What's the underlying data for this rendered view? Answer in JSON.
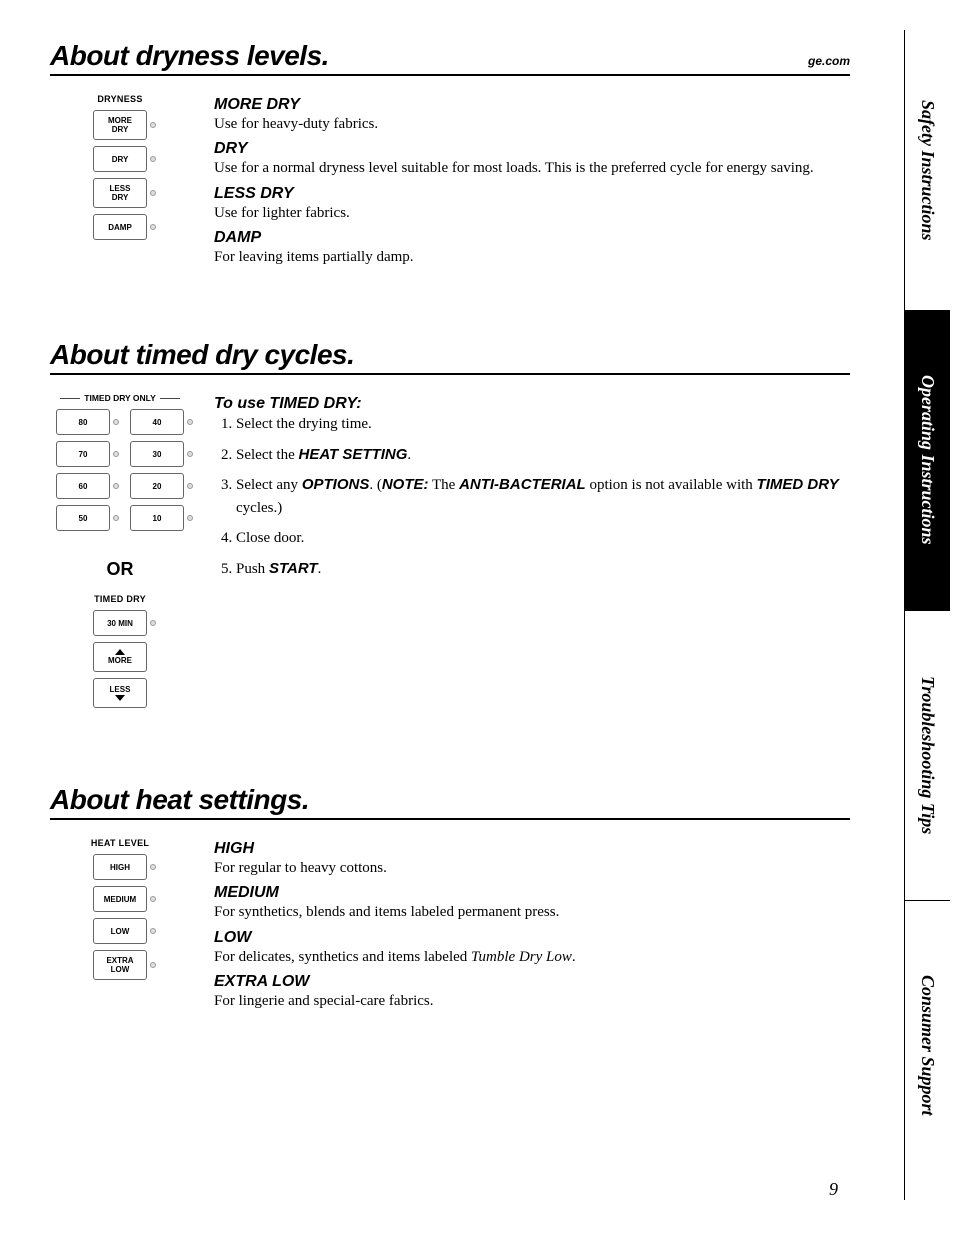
{
  "brand_link": "ge.com",
  "page_number": "9",
  "side_tabs": {
    "safety": "Safety Instructions",
    "operating": "Operating Instructions",
    "troubleshooting": "Troubleshooting Tips",
    "consumer": "Consumer Support"
  },
  "dryness": {
    "title": "About dryness levels.",
    "panel_label": "DRYNESS",
    "buttons": [
      {
        "line1": "MORE",
        "line2": "DRY"
      },
      {
        "line1": "DRY"
      },
      {
        "line1": "LESS",
        "line2": "DRY"
      },
      {
        "line1": "DAMP"
      }
    ],
    "items": [
      {
        "heading": "MORE DRY",
        "body": "Use for heavy-duty fabrics."
      },
      {
        "heading": "DRY",
        "body": "Use for a normal dryness level suitable for most loads. This is the preferred cycle for energy saving."
      },
      {
        "heading": "LESS DRY",
        "body": "Use for lighter fabrics."
      },
      {
        "heading": "DAMP",
        "body": "For leaving items partially damp."
      }
    ]
  },
  "timed": {
    "title": "About timed dry cycles.",
    "panel_label_a": "TIMED DRY ONLY",
    "buttons_left": [
      "80",
      "70",
      "60",
      "50"
    ],
    "buttons_right": [
      "40",
      "30",
      "20",
      "10"
    ],
    "or_label": "OR",
    "panel_label_b": "TIMED DRY",
    "btn_30min": "30 MIN",
    "btn_more": "MORE",
    "btn_less": "LESS",
    "subheading": "To use TIMED DRY:",
    "steps": {
      "s1": "Select the drying time.",
      "s2_pre": "Select the ",
      "s2_bold": "HEAT SETTING",
      "s2_post": ".",
      "s3_pre": "Select any ",
      "s3_bold1": "OPTIONS",
      "s3_mid1": ". (",
      "s3_bold2": "NOTE:",
      "s3_mid2": " The ",
      "s3_bold3": "ANTI-BACTERIAL",
      "s3_mid3": " option is not available with ",
      "s3_bold4": "TIMED DRY",
      "s3_post": " cycles.)",
      "s4": "Close door.",
      "s5_pre": "Push ",
      "s5_bold": "START",
      "s5_post": "."
    }
  },
  "heat": {
    "title": "About heat settings.",
    "panel_label": "HEAT LEVEL",
    "buttons": [
      {
        "line1": "HIGH"
      },
      {
        "line1": "MEDIUM"
      },
      {
        "line1": "LOW"
      },
      {
        "line1": "EXTRA",
        "line2": "LOW"
      }
    ],
    "items": [
      {
        "heading": "HIGH",
        "body": "For regular to heavy cottons."
      },
      {
        "heading": "MEDIUM",
        "body": "For synthetics, blends and items labeled permanent press."
      },
      {
        "heading": "LOW",
        "body_pre": "For delicates, synthetics and items labeled ",
        "body_ital": "Tumble Dry Low",
        "body_post": "."
      },
      {
        "heading": "EXTRA LOW",
        "body": "For lingerie and special-care fabrics."
      }
    ]
  }
}
